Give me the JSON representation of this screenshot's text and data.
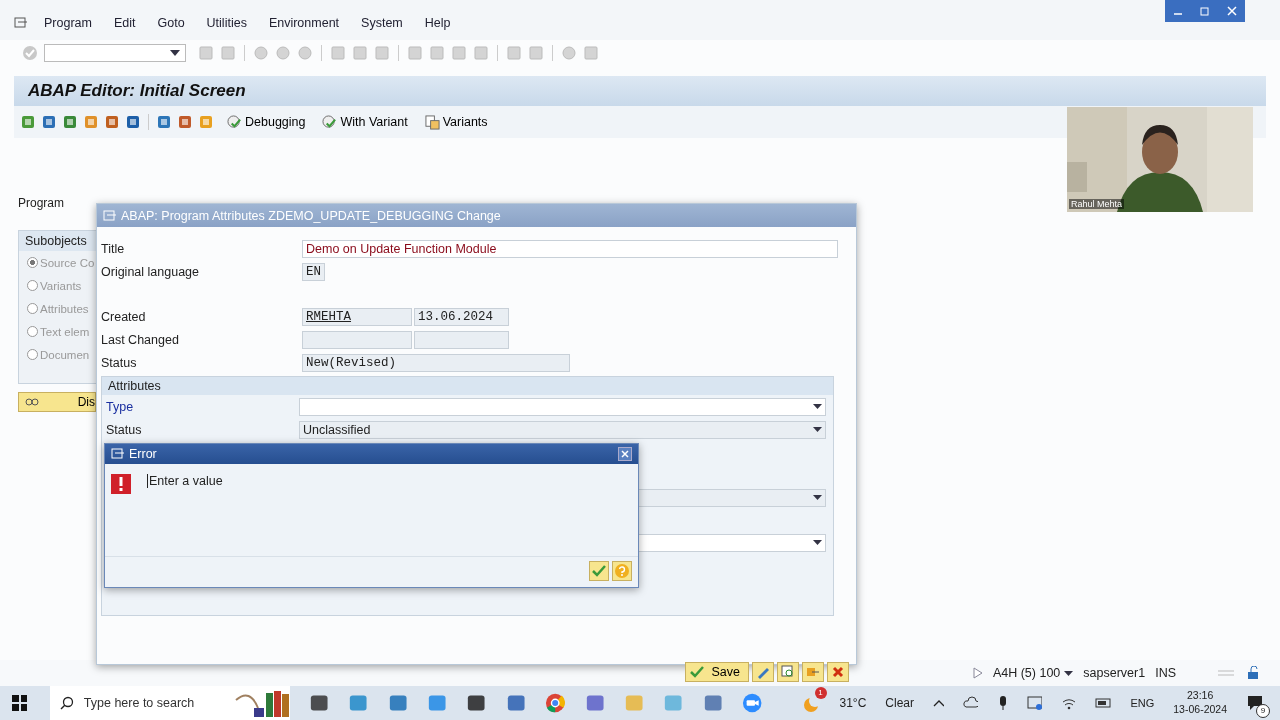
{
  "menu": [
    {
      "label": "Program"
    },
    {
      "label": "Edit"
    },
    {
      "label": "Goto"
    },
    {
      "label": "Utilities"
    },
    {
      "label": "Environment"
    },
    {
      "label": "System"
    },
    {
      "label": "Help"
    }
  ],
  "screen_title": "ABAP Editor: Initial Screen",
  "app_toolbar": [
    {
      "label": "Debugging",
      "kind": "debug"
    },
    {
      "label": "With Variant",
      "kind": "debug"
    },
    {
      "label": "Variants",
      "kind": "variants"
    }
  ],
  "program_label": "Program",
  "subobjects": {
    "title": "Subobjects",
    "options": [
      {
        "label": "Source Co",
        "selected": true
      },
      {
        "label": "Variants",
        "selected": false
      },
      {
        "label": "Attributes",
        "selected": false
      },
      {
        "label": "Text elem",
        "selected": false
      },
      {
        "label": "Documen",
        "selected": false
      }
    ]
  },
  "display_button": "Dis",
  "attributes_dialog": {
    "title": "ABAP: Program Attributes ZDEMO_UPDATE_DEBUGGING Change",
    "title_field": {
      "label": "Title",
      "value": "Demo on Update Function Module"
    },
    "language": {
      "label": "Original language",
      "value": "EN"
    },
    "created": {
      "label": "Created",
      "user": "RMEHTA",
      "date": "13.06.2024"
    },
    "last_changed": {
      "label": "Last Changed"
    },
    "status": {
      "label": "Status",
      "value": "New(Revised)"
    },
    "attributes": {
      "title": "Attributes",
      "type_label": "Type",
      "status_label": "Status",
      "status_value": "Unclassified"
    },
    "save_button": "Save"
  },
  "error_dialog": {
    "title": "Error",
    "message": "Enter a value"
  },
  "webcam": {
    "name": "Rahul Mehta"
  },
  "status_bar": {
    "system": "A4H (5) 100",
    "server": "sapserver1",
    "mode": "INS"
  },
  "taskbar": {
    "search_placeholder": "Type here to search",
    "weather_badge": "1",
    "temperature": "31°C",
    "weather": "Clear",
    "language": "ENG",
    "time": "23:16",
    "date": "13-06-2024",
    "notifications": "9"
  }
}
